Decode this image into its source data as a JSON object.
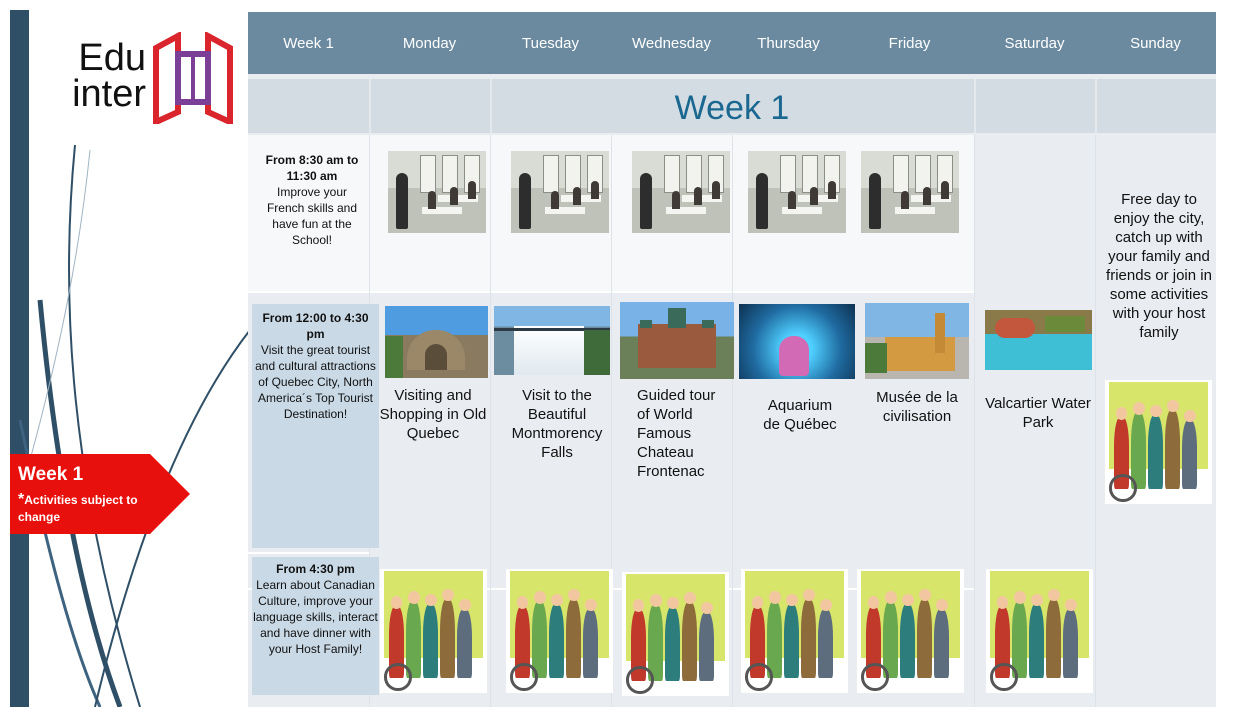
{
  "logo": {
    "line1": "Edu",
    "line2": "inter"
  },
  "tag": {
    "title": "Week 1",
    "asterisk": "*",
    "note": "Activities subject to change"
  },
  "header": {
    "week": "Week 1",
    "days": [
      "Monday",
      "Tuesday",
      "Wednesday",
      "Thursday",
      "Friday",
      "Saturday",
      "Sunday"
    ]
  },
  "band_title": "Week 1",
  "morning": {
    "time": "From 8:30 am to  11:30 am",
    "text": "Improve your French skills and  have fun at the  School!"
  },
  "afternoon": {
    "time": "From 12:00 to 4:30 pm",
    "text": "Visit the great tourist and cultural attractions of Quebec City, North America´s Top Tourist Destination!"
  },
  "evening": {
    "time": "From 4:30 pm",
    "text": "Learn about Canadian Culture, improve your language skills, interact and have dinner with your Host Family!"
  },
  "activities": {
    "monday": "Visiting and Shopping in Old Quebec",
    "tuesday": "Visit to the Beautiful Montmorency Falls",
    "wednesday": "Guided tour of World Famous Chateau Frontenac",
    "thursday": "Aquarium de Québec",
    "friday": "Musée de la civilisation",
    "saturday": "Valcartier Water Park"
  },
  "sunday": "Free day to enjoy the city, catch up with your family and friends or join in some activities with your host family",
  "colors": {
    "header": "#6b8aa0",
    "band": "#d3dce3",
    "band_title": "#1a6790",
    "tag": "#e8100c",
    "side_bar": "#2f4f67",
    "time_box": "#c9d9e6"
  },
  "icons": [
    "logo-book-icon"
  ]
}
